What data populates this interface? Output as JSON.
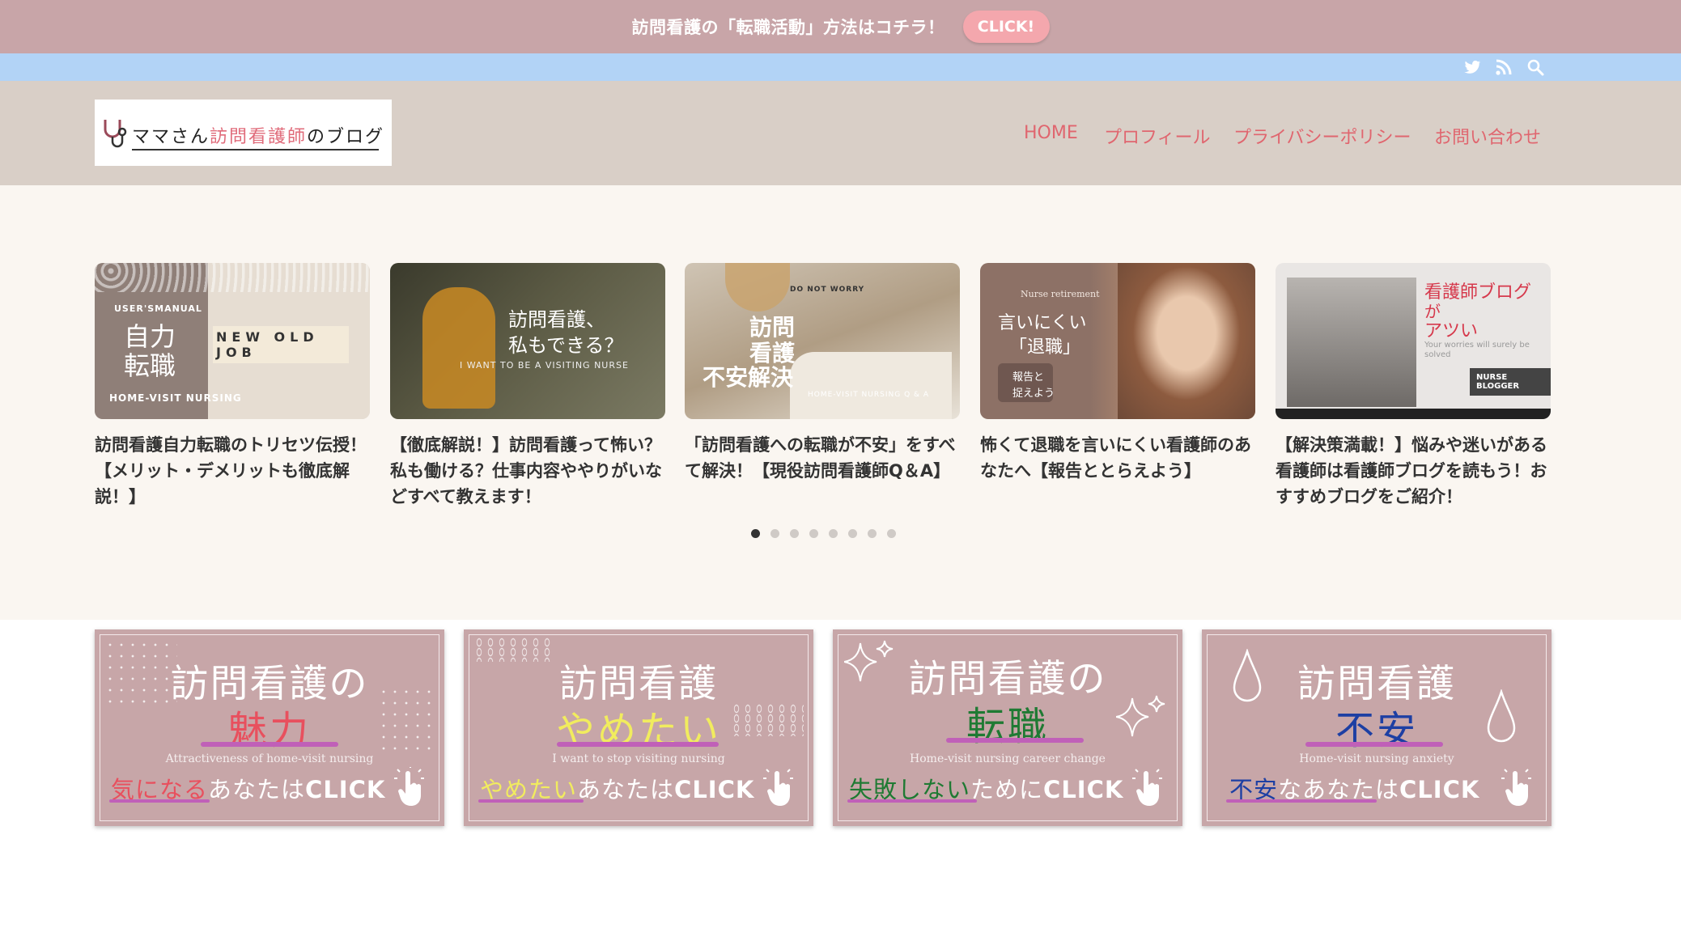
{
  "notice": {
    "text": "訪問看護の「転職活動」方法はコチラ！",
    "button_label": "CLICK!"
  },
  "social": {
    "icons": [
      "twitter-icon",
      "rss-icon",
      "search-icon"
    ]
  },
  "header": {
    "logo": {
      "prefix": "ママさん",
      "accent": "訪問看護師",
      "suffix": "のブログ"
    },
    "nav": [
      "HOME",
      "プロフィール",
      "プライバシーポリシー",
      "お問い合わせ"
    ]
  },
  "carousel": {
    "cards": [
      {
        "title": "訪問看護自力転職のトリセツ伝授！【メリット・デメリットも徹底解説！】",
        "img": {
          "top_label": "USER'SMANUAL",
          "main1": "自力",
          "main2": "転職",
          "blocks": "NEW OLD JOB",
          "bottom_label": "HOME-VISIT NURSING"
        }
      },
      {
        "title": "【徹底解説！】訪問看護って怖い？私も働ける？仕事内容ややりがいなどすべて教えます！",
        "img": {
          "main1": "訪問看護、",
          "main2": "私もできる？",
          "sub": "I WANT TO BE A VISITING NURSE"
        }
      },
      {
        "title": "「訪問看護への転職が不安」をすべて解決！【現役訪問看護師Q＆A】",
        "img": {
          "top_label": "DO NOT WORRY",
          "main1": "訪問",
          "main2": "看護",
          "main3": "不安解決",
          "sub": "HOME-VISIT NURSING Q & A"
        }
      },
      {
        "title": "怖くて退職を言いにくい看護師のあなたへ【報告ととらえよう】",
        "img": {
          "top_label": "Nurse retirement",
          "main1": "言いにくい",
          "main2": "「退職」",
          "box1": "報告と",
          "box2": "捉えよう"
        }
      },
      {
        "title": "【解決策満載！】悩みや迷いがある看護師は看護師ブログを読もう！おすすめブログをご紹介！",
        "img": {
          "main1": "看護師ブログ",
          "main2": "が",
          "main3": "アツい",
          "sub": "Your worries will surely be solved",
          "tag": "NURSE BLOGGER"
        }
      }
    ],
    "dot_count": 8,
    "active_dot": 0
  },
  "banners": [
    {
      "head": "訪問看護の",
      "key": "魅力",
      "key_color": "#e8505e",
      "sub": "Attractiveness of home-visit nursing",
      "cta_key": "気になる",
      "cta_rest": "あなたは",
      "cta_click": "CLICK"
    },
    {
      "head": "訪問看護",
      "key": "やめたい",
      "key_color": "#f1ec5e",
      "sub": "I want to stop visiting nursing",
      "cta_key": "やめたい",
      "cta_rest": "あなたは",
      "cta_click": "CLICK"
    },
    {
      "head": "訪問看護の",
      "key": "転職",
      "key_color": "#1f7a33",
      "sub": "Home-visit nursing career change",
      "cta_key": "失敗しない",
      "cta_rest": "ために",
      "cta_click": "CLICK"
    },
    {
      "head": "訪問看護",
      "key": "不安",
      "key_color": "#1d3fa3",
      "sub": "Home-visit nursing anxiety",
      "cta_key": "不安",
      "cta_rest": "なあなたは",
      "cta_click": "CLICK"
    }
  ]
}
